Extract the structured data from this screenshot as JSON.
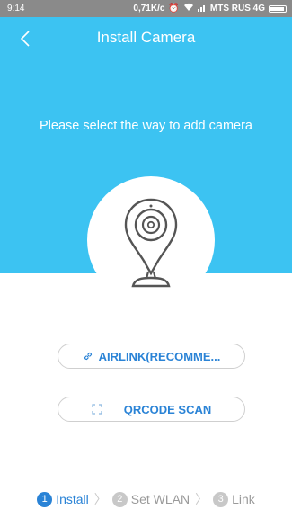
{
  "status_bar": {
    "time": "9:14",
    "speed": "0,71K/c",
    "carrier": "MTS RUS 4G"
  },
  "header": {
    "title": "Install Camera"
  },
  "hero": {
    "subtitle": "Please select the way to add camera"
  },
  "options": {
    "airlink_label": "AIRLINK(RECOMME...",
    "qrcode_label": "QRCODE SCAN"
  },
  "steps": [
    {
      "number": "1",
      "label": "Install",
      "active": true
    },
    {
      "number": "2",
      "label": "Set WLAN",
      "active": false
    },
    {
      "number": "3",
      "label": "Link",
      "active": false
    }
  ],
  "colors": {
    "hero_background": "#3cc3f2",
    "accent": "#2a83d6",
    "status_bar": "#8a8a8a"
  }
}
